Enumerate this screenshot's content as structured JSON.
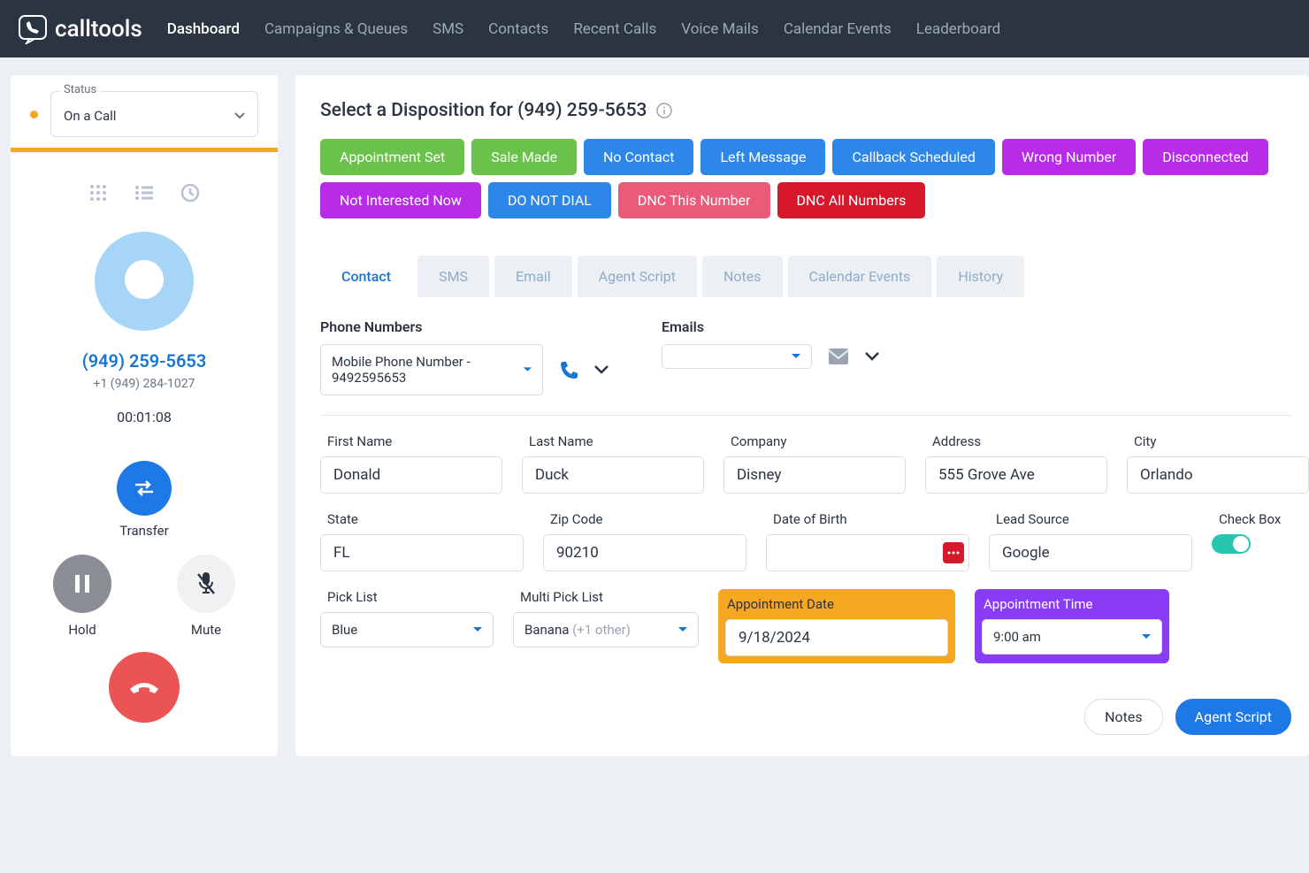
{
  "brand": "calltools",
  "nav": [
    "Dashboard",
    "Campaigns & Queues",
    "SMS",
    "Contacts",
    "Recent Calls",
    "Voice Mails",
    "Calendar Events",
    "Leaderboard"
  ],
  "navActive": 0,
  "status": {
    "label": "Status",
    "value": "On a Call"
  },
  "call": {
    "phone": "(949) 259-5653",
    "secondary": "+1 (949) 284-1027",
    "timer": "00:01:08"
  },
  "controls": {
    "transfer": "Transfer",
    "hold": "Hold",
    "mute": "Mute"
  },
  "dispTitle": "Select a Disposition for (949) 259-5653",
  "dispositions": [
    {
      "label": "Appointment Set",
      "cls": "d-green"
    },
    {
      "label": "Sale Made",
      "cls": "d-green"
    },
    {
      "label": "No Contact",
      "cls": "d-blue"
    },
    {
      "label": "Left Message",
      "cls": "d-blue"
    },
    {
      "label": "Callback Scheduled",
      "cls": "d-blue"
    },
    {
      "label": "Wrong Number",
      "cls": "d-purple"
    },
    {
      "label": "Disconnected",
      "cls": "d-purple"
    },
    {
      "label": "Not Interested Now",
      "cls": "d-purple"
    },
    {
      "label": "DO NOT DIAL",
      "cls": "d-blue"
    },
    {
      "label": "DNC This Number",
      "cls": "d-pink"
    },
    {
      "label": "DNC All Numbers",
      "cls": "d-red"
    }
  ],
  "tabs": [
    "Contact",
    "SMS",
    "Email",
    "Agent Script",
    "Notes",
    "Calendar Events",
    "History"
  ],
  "tabActive": 0,
  "sections": {
    "phoneNumbers": {
      "label": "Phone Numbers",
      "value": "Mobile Phone Number - 9492595653"
    },
    "emails": {
      "label": "Emails",
      "value": ""
    }
  },
  "fields": {
    "firstName": {
      "label": "First Name",
      "value": "Donald"
    },
    "lastName": {
      "label": "Last Name",
      "value": "Duck"
    },
    "company": {
      "label": "Company",
      "value": "Disney"
    },
    "address": {
      "label": "Address",
      "value": "555 Grove Ave"
    },
    "city": {
      "label": "City",
      "value": "Orlando"
    },
    "state": {
      "label": "State",
      "value": "FL"
    },
    "zip": {
      "label": "Zip Code",
      "value": "90210"
    },
    "dob": {
      "label": "Date of Birth",
      "value": ""
    },
    "leadSource": {
      "label": "Lead Source",
      "value": "Google"
    },
    "checkbox": {
      "label": "Check Box"
    },
    "pickList": {
      "label": "Pick List",
      "value": "Blue"
    },
    "multiPick": {
      "label": "Multi Pick List",
      "value": "Banana",
      "extra": "(+1 other)"
    },
    "apptDate": {
      "label": "Appointment Date",
      "value": "9/18/2024"
    },
    "apptTime": {
      "label": "Appointment Time",
      "value": "9:00 am"
    }
  },
  "bottomBtns": {
    "notes": "Notes",
    "agentScript": "Agent Script"
  }
}
